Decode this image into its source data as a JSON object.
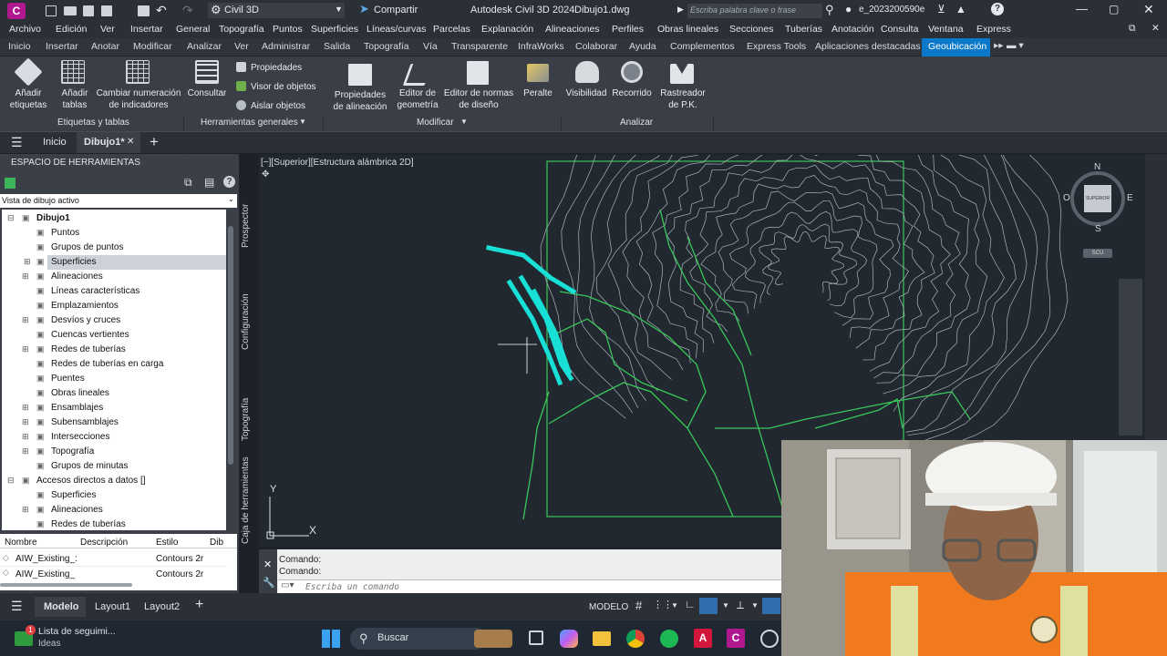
{
  "titlebar": {
    "logo": "C",
    "workspace": "Civil 3D",
    "share": "Compartir",
    "app_title": "Autodesk Civil 3D 2024",
    "file": "Dibujo1.dwg",
    "search_placeholder": "Escriba palabra clave o frase",
    "user": "e_2023200590e"
  },
  "menubar": [
    "Archivo",
    "Edición",
    "Ver",
    "Insertar",
    "General",
    "Topografía",
    "Puntos",
    "Superficies",
    "Líneas/curvas",
    "Parcelas",
    "Explanación",
    "Alineaciones",
    "Perfiles",
    "Obras lineales",
    "Secciones",
    "Tuberías",
    "Anotación",
    "Consulta",
    "Ventana",
    "Express"
  ],
  "ribbon_tabs": [
    "Inicio",
    "Insertar",
    "Anotar",
    "Modificar",
    "Analizar",
    "Ver",
    "Administrar",
    "Salida",
    "Topografía",
    "Vía",
    "Transparente",
    "InfraWorks",
    "Colaborar",
    "Ayuda",
    "Complementos",
    "Express Tools",
    "Aplicaciones destacadas",
    "Geoubicación"
  ],
  "active_ribbon_tab": "Geoubicación",
  "ribbon": {
    "b_add_labels": "Añadir etiquetas",
    "b_add_tables": "Añadir tablas",
    "b_renumber": "Cambiar numeración de indicadores",
    "b_query": "Consultar",
    "b_properties": "Propiedades",
    "b_object_viewer": "Visor de objetos",
    "b_isolate": "Aislar objetos",
    "b_align_props": "Propiedades de alineación",
    "b_geom_editor": "Editor de geometría",
    "b_std_editor": "Editor de normas de diseño",
    "b_superelev": "Peralte",
    "b_visibility": "Visibilidad",
    "b_flyby": "Recorrido",
    "b_station_tracker": "Rastreador de P.K.",
    "p_labels": "Etiquetas y tablas",
    "p_general": "Herramientas generales",
    "p_modify": "Modificar",
    "p_analyze": "Analizar"
  },
  "doc_tabs": {
    "home": "Inicio",
    "drawing": "Dibujo1*"
  },
  "toolspace": {
    "title": "ESPACIO DE HERRAMIENTAS",
    "view": "Vista de dibujo activo",
    "tree": [
      "Dibujo1",
      "Puntos",
      "Grupos de puntos",
      "Superficies",
      "Alineaciones",
      "Líneas características",
      "Emplazamientos",
      "Desvíos y cruces",
      "Cuencas vertientes",
      "Redes de tuberías",
      "Redes de tuberías en carga",
      "Puentes",
      "Obras lineales",
      "Ensamblajes",
      "Subensamblajes",
      "Intersecciones",
      "Topografía",
      "Grupos de minutas",
      "Accesos directos a datos []",
      "Superficies",
      "Alineaciones",
      "Redes de tuberías"
    ],
    "side_tabs": [
      "Prospector",
      "Configuración",
      "Topografía",
      "Caja de herramientas"
    ],
    "list_headers": [
      "Nombre",
      "Descripción",
      "Estilo",
      "Dib"
    ],
    "list_rows": [
      [
        "AIW_Existing_:",
        "",
        "Contours 2r",
        ""
      ],
      [
        "AIW_Existing_",
        "",
        "Contours 2r",
        ""
      ]
    ]
  },
  "viewport": {
    "label": "[−][Superior][Estructura alámbrica 2D]",
    "compass": {
      "n": "N",
      "s": "S",
      "e": "E",
      "o": "O",
      "cube": "SUPERIOR",
      "wcs": "SCU"
    },
    "ucs_x": "X",
    "ucs_y": "Y"
  },
  "command": {
    "line1": "Comando:",
    "line2": "Comando:",
    "placeholder": "Escriba un comando"
  },
  "status": {
    "model_tab": "Modelo",
    "layout1": "Layout1",
    "layout2": "Layout2",
    "space": "MODELO"
  },
  "taskbar": {
    "app": "Lista de seguimi...",
    "app_sub": "Ideas",
    "search": "Buscar",
    "badge": "1"
  },
  "colors": {
    "accent": "#0a79c9",
    "contour": "#aab3bb",
    "green": "#39c75a",
    "cyan": "#19e0d7"
  }
}
